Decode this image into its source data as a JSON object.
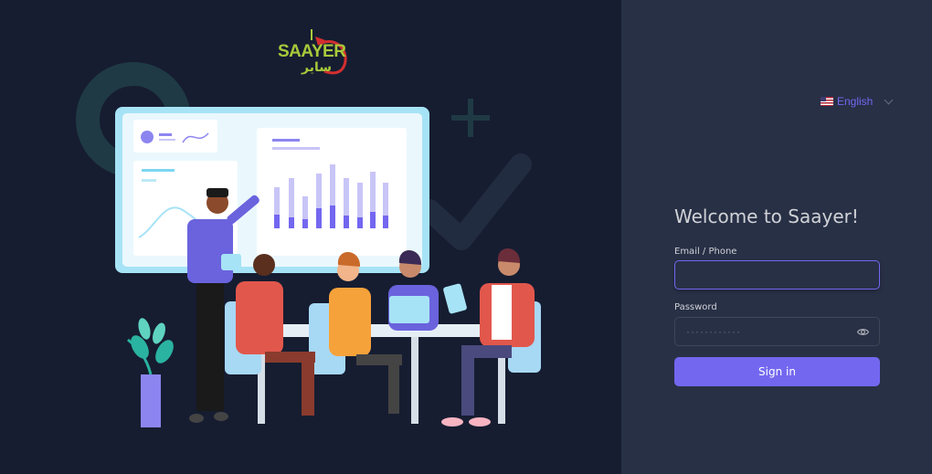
{
  "brand": {
    "name_en": "SAAYER",
    "name_ar": "ساير",
    "accent": "#7367f0",
    "logo_green": "#a8c93a",
    "logo_red": "#d32f2f"
  },
  "illustration": {
    "description_icon": "team-meeting-illustration"
  },
  "language": {
    "label": "English",
    "flag_icon": "us-flag-icon",
    "chevron_icon": "chevron-down-icon"
  },
  "login": {
    "title": "Welcome to Saayer!",
    "email_label": "Email / Phone",
    "email_value": "",
    "password_label": "Password",
    "password_placeholder": "············",
    "toggle_icon": "eye-icon",
    "submit_label": "Sign in"
  }
}
